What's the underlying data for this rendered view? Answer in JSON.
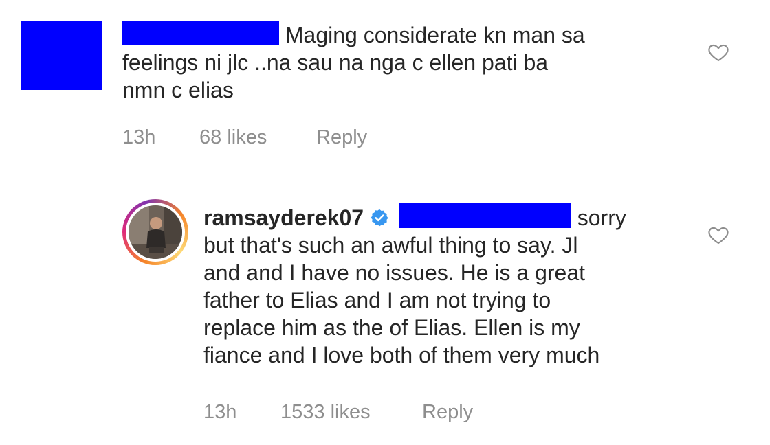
{
  "comment1": {
    "text_line1": "Maging considerate kn man sa",
    "text_line2": "feelings ni jlc ..na sau na nga c ellen pati ba",
    "text_line3": "nmn c elias",
    "time": "13h",
    "likes": "68 likes",
    "reply_label": "Reply"
  },
  "comment2": {
    "username": "ramsayderek07",
    "text_line1_tail": "sorry",
    "text_line2": "but that's such an awful thing to say. Jl",
    "text_line3": "and and I have no issues. He is a great",
    "text_line4": "father to Elias and I am not trying to",
    "text_line5": "replace him as the of Elias. Ellen is my",
    "text_line6": "fiance and I love both of them very much",
    "time": "13h",
    "likes": "1533 likes",
    "reply_label": "Reply"
  },
  "icons": {
    "like": "heart-outline-icon",
    "verified": "verified-badge-icon"
  },
  "colors": {
    "redaction": "#0000ff",
    "text": "#262626",
    "meta": "#8e8e8e",
    "verified": "#3897f0"
  }
}
